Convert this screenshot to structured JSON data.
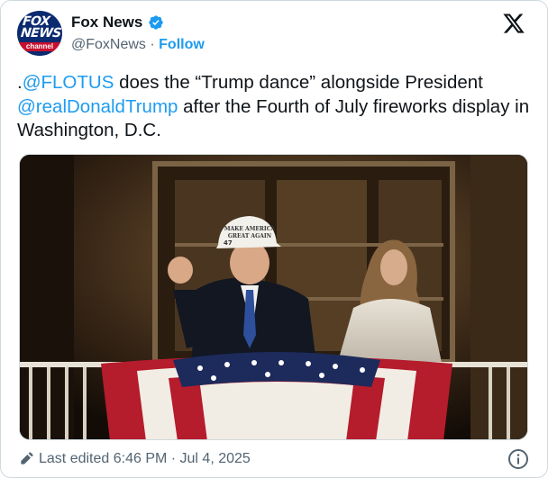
{
  "account": {
    "name": "Fox News",
    "handle": "@FoxNews",
    "separator": "·",
    "follow_label": "Follow",
    "avatar_text": {
      "line1": "FOX",
      "line2": "NEWS",
      "line3": "channel"
    }
  },
  "tweet": {
    "part1": ".",
    "mention1": "@FLOTUS",
    "part2": " does the “Trump dance” alongside President ",
    "mention2": "@realDonaldTrump",
    "part3": " after the Fourth of July fireworks display in Washington, D.C."
  },
  "media": {
    "hat_text_line1": "MAKE AMERICA",
    "hat_text_line2": "GREAT AGAIN",
    "hat_number": "47"
  },
  "footer": {
    "edited_label": "Last edited 6:46 PM · Jul 4, 2025"
  },
  "colors": {
    "accent": "#1d9bf0",
    "text": "#0f1419",
    "muted": "#536471",
    "fox_blue": "#0b2a6f",
    "fox_red": "#c8102e"
  },
  "icons": {
    "verified": "verified-badge-icon",
    "platform": "x-logo-icon",
    "edit": "pencil-icon",
    "info": "info-icon"
  }
}
